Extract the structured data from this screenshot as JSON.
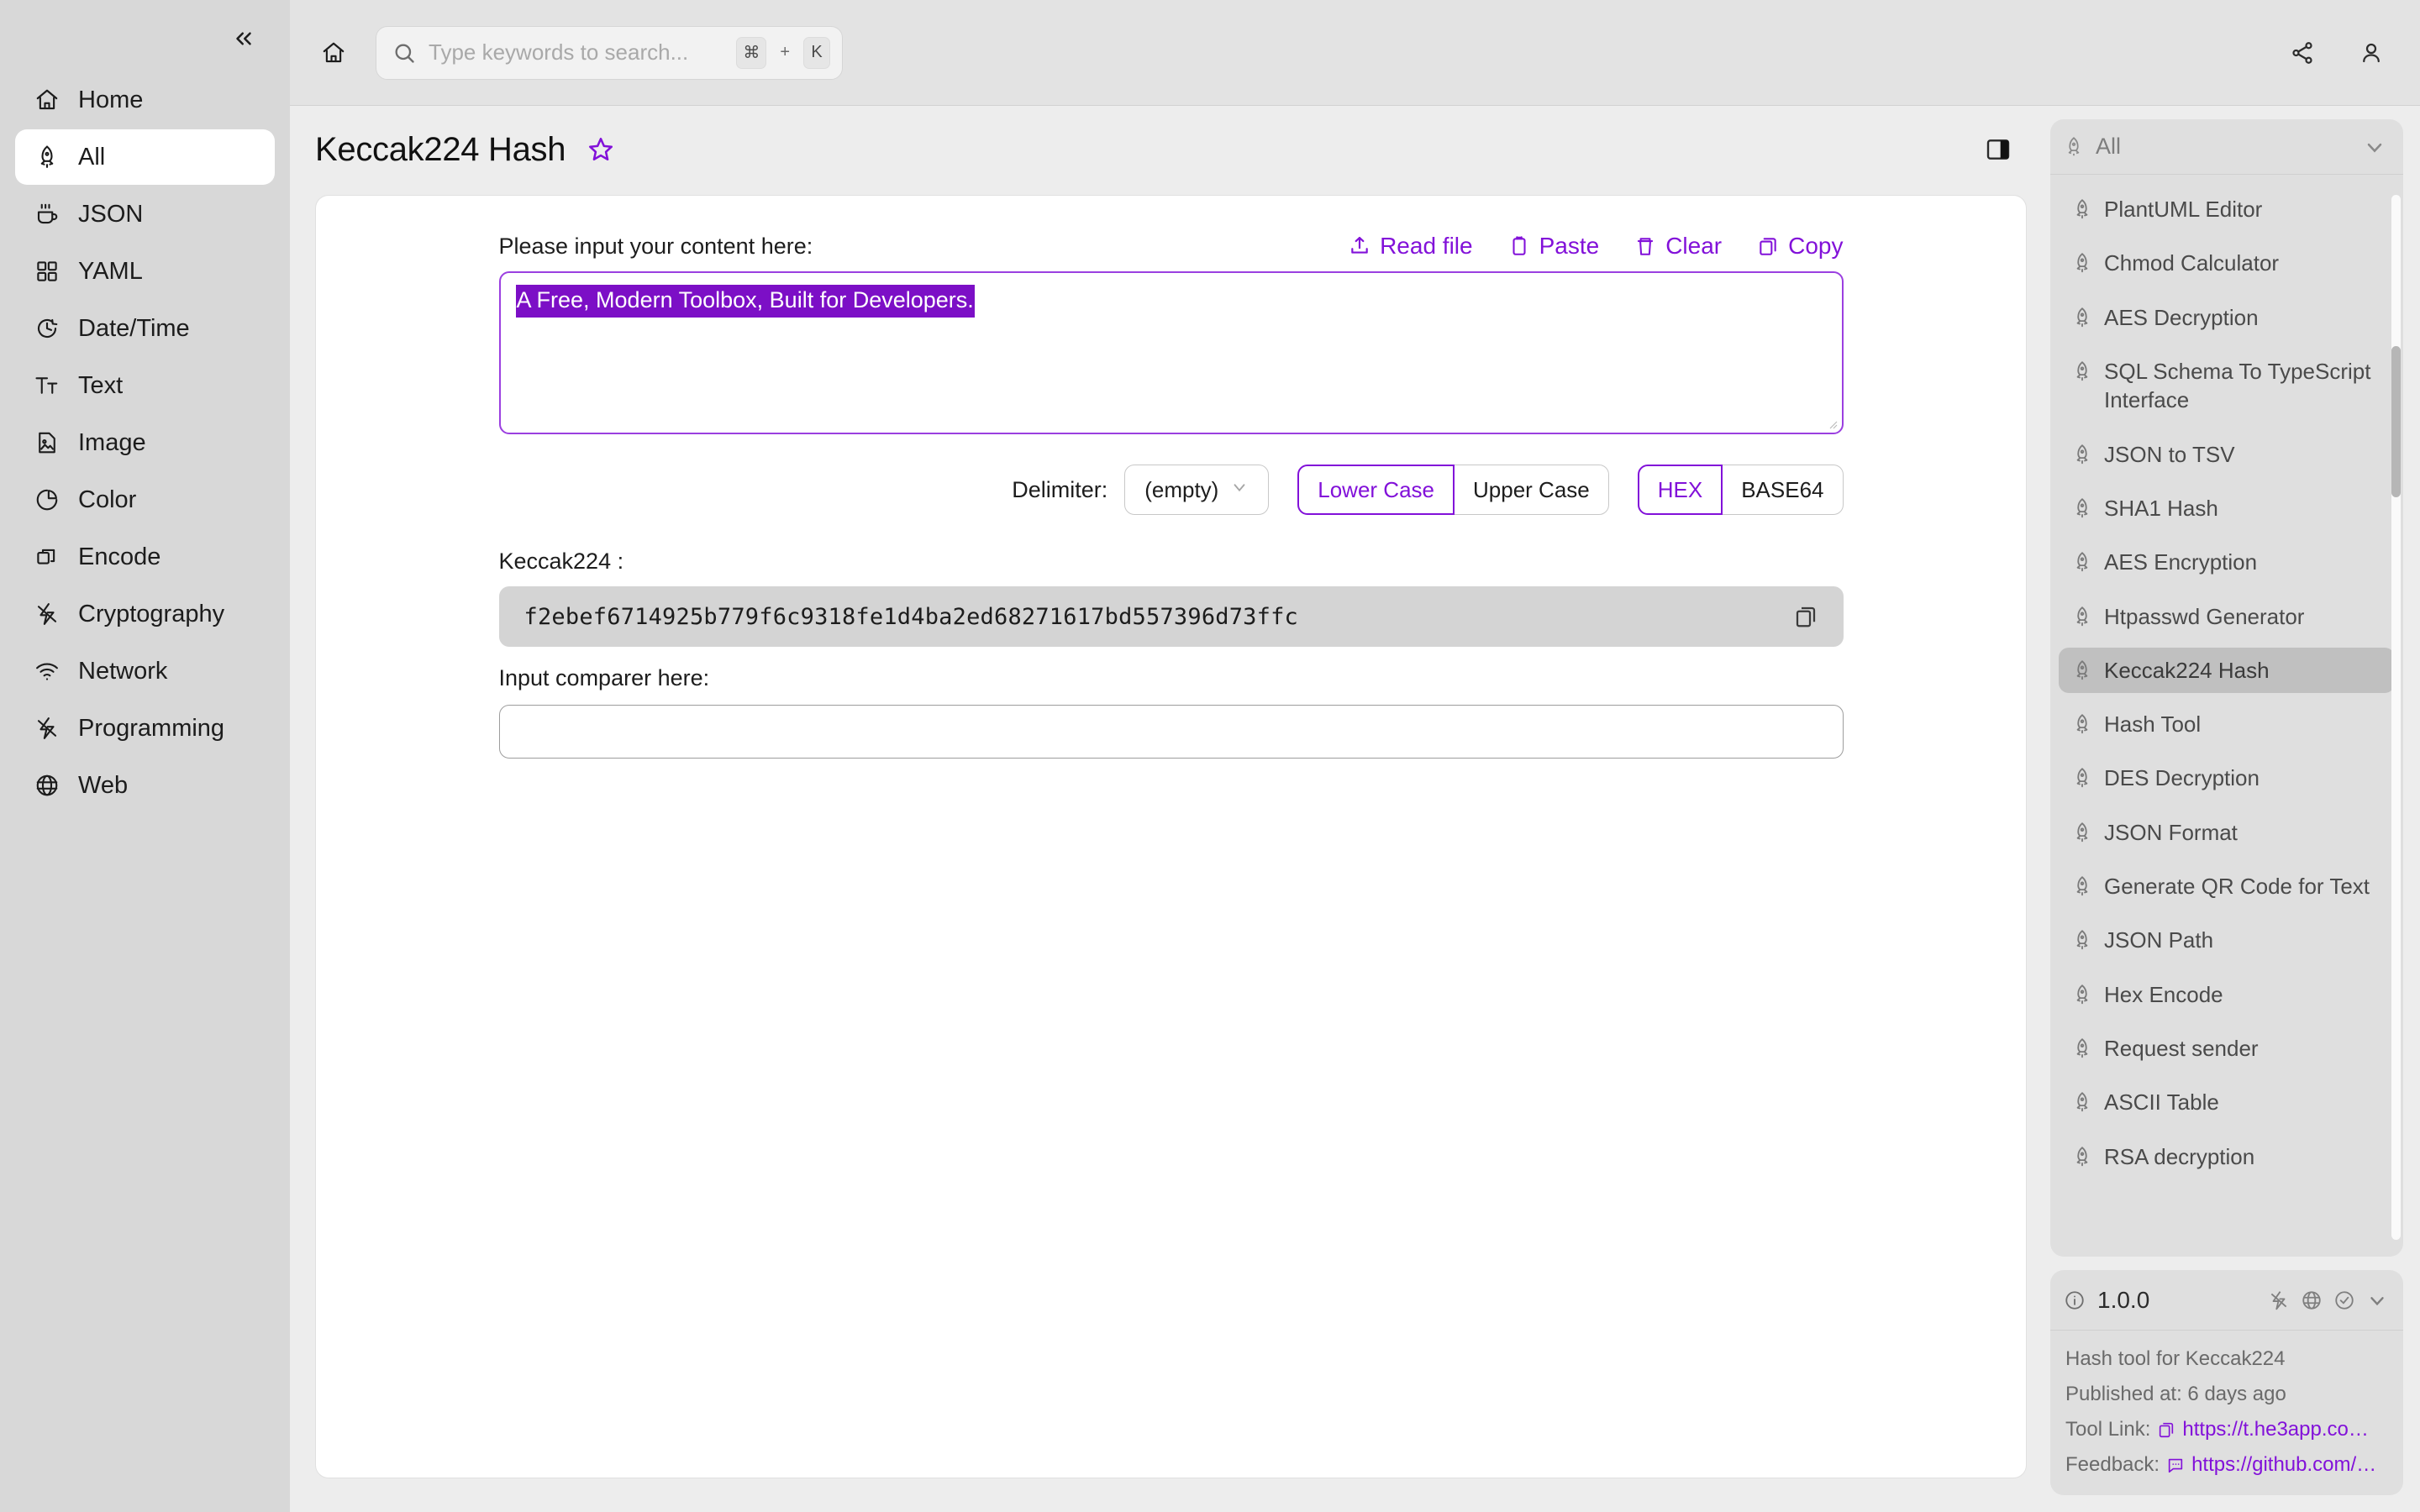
{
  "sidebar": {
    "collapse_icon": "chevrons-left-icon",
    "items": [
      {
        "label": "Home",
        "icon": "home-icon",
        "active": false
      },
      {
        "label": "All",
        "icon": "rocket-icon",
        "active": true
      },
      {
        "label": "JSON",
        "icon": "coffee-icon",
        "active": false
      },
      {
        "label": "YAML",
        "icon": "grid-icon",
        "active": false
      },
      {
        "label": "Date/Time",
        "icon": "clock-icon",
        "active": false
      },
      {
        "label": "Text",
        "icon": "text-icon",
        "active": false
      },
      {
        "label": "Image",
        "icon": "image-icon",
        "active": false
      },
      {
        "label": "Color",
        "icon": "pie-chart-icon",
        "active": false
      },
      {
        "label": "Encode",
        "icon": "layers-icon",
        "active": false
      },
      {
        "label": "Cryptography",
        "icon": "lightning-icon",
        "active": false
      },
      {
        "label": "Network",
        "icon": "wifi-icon",
        "active": false
      },
      {
        "label": "Programming",
        "icon": "lightning-icon",
        "active": false
      },
      {
        "label": "Web",
        "icon": "globe-icon",
        "active": false
      }
    ]
  },
  "topbar": {
    "home_icon": "home-icon",
    "search": {
      "placeholder": "Type keywords to search...",
      "icon": "search-icon",
      "shortcut_mod": "⌘",
      "shortcut_plus": "+",
      "shortcut_key": "K"
    },
    "share_icon": "share-icon",
    "account_icon": "user-icon"
  },
  "page": {
    "title": "Keccak224 Hash",
    "favorite_icon": "star-icon",
    "panel_toggle_icon": "panel-right-icon"
  },
  "tool": {
    "input_label": "Please input your content here:",
    "input_value": "A Free, Modern Toolbox, Built for Developers.",
    "actions": [
      {
        "label": "Read file",
        "icon": "upload-icon"
      },
      {
        "label": "Paste",
        "icon": "clipboard-icon"
      },
      {
        "label": "Clear",
        "icon": "trash-icon"
      },
      {
        "label": "Copy",
        "icon": "copy-icon"
      }
    ],
    "delimiter_label": "Delimiter:",
    "delimiter_value": "(empty)",
    "delimiter_chevron": "chevron-down-icon",
    "case_options": [
      {
        "label": "Lower Case",
        "selected": true
      },
      {
        "label": "Upper Case",
        "selected": false
      }
    ],
    "encoding_options": [
      {
        "label": "HEX",
        "selected": true
      },
      {
        "label": "BASE64",
        "selected": false
      }
    ],
    "result_label": "Keccak224 :",
    "result_value": "f2ebef6714925b779f6c9318fe1d4ba2ed68271617bd557396d73ffc",
    "result_copy_icon": "copy-icon",
    "comparer_label": "Input comparer here:",
    "comparer_value": ""
  },
  "tools_panel": {
    "header_label": "All",
    "header_icon": "rocket-icon",
    "header_chevron": "chevron-down-icon",
    "items": [
      {
        "label": "PlantUML Editor",
        "active": false
      },
      {
        "label": "Chmod Calculator",
        "active": false
      },
      {
        "label": "AES Decryption",
        "active": false
      },
      {
        "label": "SQL Schema To TypeScript Interface",
        "active": false
      },
      {
        "label": "JSON to TSV",
        "active": false
      },
      {
        "label": "SHA1 Hash",
        "active": false
      },
      {
        "label": "AES Encryption",
        "active": false
      },
      {
        "label": "Htpasswd Generator",
        "active": false
      },
      {
        "label": "Keccak224 Hash",
        "active": true
      },
      {
        "label": "Hash Tool",
        "active": false
      },
      {
        "label": "DES Decryption",
        "active": false
      },
      {
        "label": "JSON Format",
        "active": false
      },
      {
        "label": "Generate QR Code for Text",
        "active": false
      },
      {
        "label": "JSON Path",
        "active": false
      },
      {
        "label": "Hex Encode",
        "active": false
      },
      {
        "label": "Request sender",
        "active": false
      },
      {
        "label": "ASCII Table",
        "active": false
      },
      {
        "label": "RSA decryption",
        "active": false
      }
    ]
  },
  "info_panel": {
    "info_icon": "info-icon",
    "version": "1.0.0",
    "head_icons": [
      "lightning-icon",
      "globe-icon",
      "check-circle-icon",
      "chevron-down-icon"
    ],
    "description": "Hash tool for Keccak224",
    "published": "Published at: 6 days ago",
    "tool_link_label": "Tool Link:",
    "tool_link_value": "https://t.he3app.co…",
    "tool_link_icon": "copy-icon",
    "feedback_label": "Feedback:",
    "feedback_value": "https://github.com/…",
    "feedback_icon": "message-icon"
  },
  "colors": {
    "accent": "#8211d9",
    "selection_bg": "#7c0fc6",
    "sidebar_bg": "#d8d8d8",
    "panel_bg": "#dfdfdf",
    "result_bg": "#d4d4d4"
  }
}
